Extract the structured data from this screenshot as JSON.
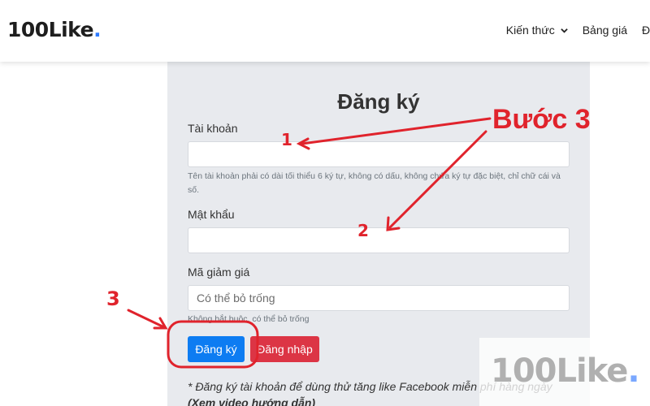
{
  "header": {
    "logo_text": "100Like",
    "logo_dot": ".",
    "nav": [
      {
        "label": "Kiến thức",
        "has_dropdown": true
      },
      {
        "label": "Bảng giá"
      },
      {
        "label": "Đ"
      }
    ]
  },
  "form": {
    "title": "Đăng ký",
    "account_label": "Tài khoản",
    "account_value": "",
    "account_hint": "Tên tài khoản phải có dài tối thiểu 6 ký tự, không có dấu, không chứa ký tự đặc biệt, chỉ chữ cái và số.",
    "password_label": "Mật khẩu",
    "password_value": "",
    "coupon_label": "Mã giảm giá",
    "coupon_placeholder": "Có thể bỏ trống",
    "coupon_hint": "Không bắt buộc, có thể bỏ trống",
    "register_button": "Đăng ký",
    "login_button": "Đăng nhập",
    "note": "* Đăng ký tài khoản để dùng thử tăng like Facebook miễn phí hàng ngày",
    "note_link": "(Xem video hướng dẫn)"
  },
  "annotations": {
    "step_title": "Bước 3",
    "marker_1": "1",
    "marker_2": "2",
    "marker_3": "3",
    "color": "#e0232c"
  },
  "watermark": {
    "text": "100Like",
    "dot": "."
  },
  "colors": {
    "primary": "#0d7cf2",
    "danger": "#dc3545",
    "panel_bg": "#e8eaee",
    "logo_dot": "#2f7bff"
  }
}
